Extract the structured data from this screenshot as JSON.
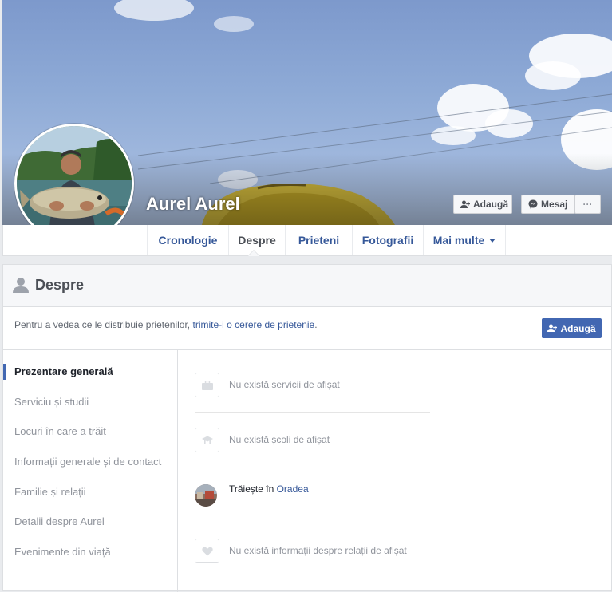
{
  "profile": {
    "name": "Aurel Aurel"
  },
  "header_buttons": {
    "add_friend": "Adaugă",
    "message": "Mesaj",
    "more": "···"
  },
  "tabs": [
    {
      "label": "Cronologie"
    },
    {
      "label": "Despre"
    },
    {
      "label": "Prieteni"
    },
    {
      "label": "Fotografii"
    },
    {
      "label": "Mai multe"
    }
  ],
  "about": {
    "title": "Despre",
    "notice_prefix": "Pentru a vedea ce le distribuie prietenilor,",
    "notice_link": "trimite-i o cerere de prietenie",
    "notice_suffix": ".",
    "add_button": "Adaugă"
  },
  "sidebar": {
    "items": [
      {
        "label": "Prezentare generală",
        "active": true
      },
      {
        "label": "Serviciu și studii"
      },
      {
        "label": "Locuri în care a trăit"
      },
      {
        "label": "Informații generale și de contact"
      },
      {
        "label": "Familie și relații"
      },
      {
        "label": "Detalii despre Aurel"
      },
      {
        "label": "Evenimente din viață"
      }
    ]
  },
  "overview": {
    "work": "Nu există servicii de afișat",
    "school": "Nu există școli de afișat",
    "lives_prefix": "Trăiește în",
    "lives_city": "Oradea",
    "relationship": "Nu există informații despre relații de afișat"
  },
  "colors": {
    "accent": "#4267b2",
    "link": "#365899",
    "muted": "#90949c"
  },
  "icons": [
    "person-add-icon",
    "messenger-icon",
    "person-icon",
    "briefcase-icon",
    "graduation-icon",
    "heart-icon"
  ]
}
